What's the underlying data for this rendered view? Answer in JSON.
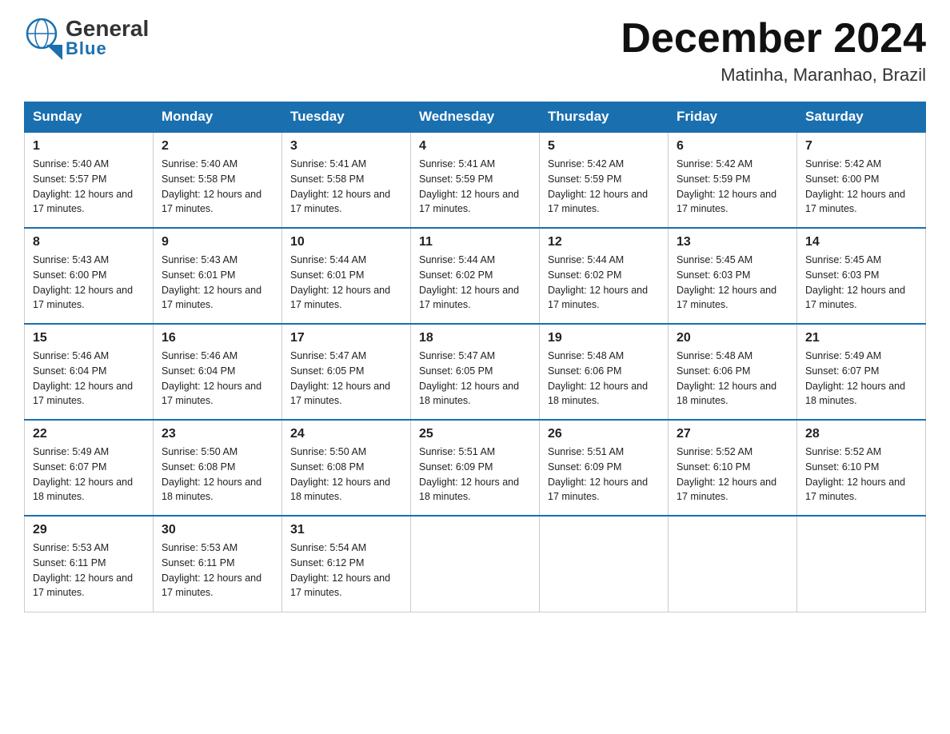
{
  "header": {
    "logo_general": "General",
    "logo_blue": "Blue",
    "month_title": "December 2024",
    "location": "Matinha, Maranhao, Brazil"
  },
  "days_of_week": [
    "Sunday",
    "Monday",
    "Tuesday",
    "Wednesday",
    "Thursday",
    "Friday",
    "Saturday"
  ],
  "weeks": [
    [
      {
        "day": "1",
        "sunrise": "5:40 AM",
        "sunset": "5:57 PM",
        "daylight": "12 hours and 17 minutes."
      },
      {
        "day": "2",
        "sunrise": "5:40 AM",
        "sunset": "5:58 PM",
        "daylight": "12 hours and 17 minutes."
      },
      {
        "day": "3",
        "sunrise": "5:41 AM",
        "sunset": "5:58 PM",
        "daylight": "12 hours and 17 minutes."
      },
      {
        "day": "4",
        "sunrise": "5:41 AM",
        "sunset": "5:59 PM",
        "daylight": "12 hours and 17 minutes."
      },
      {
        "day": "5",
        "sunrise": "5:42 AM",
        "sunset": "5:59 PM",
        "daylight": "12 hours and 17 minutes."
      },
      {
        "day": "6",
        "sunrise": "5:42 AM",
        "sunset": "5:59 PM",
        "daylight": "12 hours and 17 minutes."
      },
      {
        "day": "7",
        "sunrise": "5:42 AM",
        "sunset": "6:00 PM",
        "daylight": "12 hours and 17 minutes."
      }
    ],
    [
      {
        "day": "8",
        "sunrise": "5:43 AM",
        "sunset": "6:00 PM",
        "daylight": "12 hours and 17 minutes."
      },
      {
        "day": "9",
        "sunrise": "5:43 AM",
        "sunset": "6:01 PM",
        "daylight": "12 hours and 17 minutes."
      },
      {
        "day": "10",
        "sunrise": "5:44 AM",
        "sunset": "6:01 PM",
        "daylight": "12 hours and 17 minutes."
      },
      {
        "day": "11",
        "sunrise": "5:44 AM",
        "sunset": "6:02 PM",
        "daylight": "12 hours and 17 minutes."
      },
      {
        "day": "12",
        "sunrise": "5:44 AM",
        "sunset": "6:02 PM",
        "daylight": "12 hours and 17 minutes."
      },
      {
        "day": "13",
        "sunrise": "5:45 AM",
        "sunset": "6:03 PM",
        "daylight": "12 hours and 17 minutes."
      },
      {
        "day": "14",
        "sunrise": "5:45 AM",
        "sunset": "6:03 PM",
        "daylight": "12 hours and 17 minutes."
      }
    ],
    [
      {
        "day": "15",
        "sunrise": "5:46 AM",
        "sunset": "6:04 PM",
        "daylight": "12 hours and 17 minutes."
      },
      {
        "day": "16",
        "sunrise": "5:46 AM",
        "sunset": "6:04 PM",
        "daylight": "12 hours and 17 minutes."
      },
      {
        "day": "17",
        "sunrise": "5:47 AM",
        "sunset": "6:05 PM",
        "daylight": "12 hours and 17 minutes."
      },
      {
        "day": "18",
        "sunrise": "5:47 AM",
        "sunset": "6:05 PM",
        "daylight": "12 hours and 18 minutes."
      },
      {
        "day": "19",
        "sunrise": "5:48 AM",
        "sunset": "6:06 PM",
        "daylight": "12 hours and 18 minutes."
      },
      {
        "day": "20",
        "sunrise": "5:48 AM",
        "sunset": "6:06 PM",
        "daylight": "12 hours and 18 minutes."
      },
      {
        "day": "21",
        "sunrise": "5:49 AM",
        "sunset": "6:07 PM",
        "daylight": "12 hours and 18 minutes."
      }
    ],
    [
      {
        "day": "22",
        "sunrise": "5:49 AM",
        "sunset": "6:07 PM",
        "daylight": "12 hours and 18 minutes."
      },
      {
        "day": "23",
        "sunrise": "5:50 AM",
        "sunset": "6:08 PM",
        "daylight": "12 hours and 18 minutes."
      },
      {
        "day": "24",
        "sunrise": "5:50 AM",
        "sunset": "6:08 PM",
        "daylight": "12 hours and 18 minutes."
      },
      {
        "day": "25",
        "sunrise": "5:51 AM",
        "sunset": "6:09 PM",
        "daylight": "12 hours and 18 minutes."
      },
      {
        "day": "26",
        "sunrise": "5:51 AM",
        "sunset": "6:09 PM",
        "daylight": "12 hours and 17 minutes."
      },
      {
        "day": "27",
        "sunrise": "5:52 AM",
        "sunset": "6:10 PM",
        "daylight": "12 hours and 17 minutes."
      },
      {
        "day": "28",
        "sunrise": "5:52 AM",
        "sunset": "6:10 PM",
        "daylight": "12 hours and 17 minutes."
      }
    ],
    [
      {
        "day": "29",
        "sunrise": "5:53 AM",
        "sunset": "6:11 PM",
        "daylight": "12 hours and 17 minutes."
      },
      {
        "day": "30",
        "sunrise": "5:53 AM",
        "sunset": "6:11 PM",
        "daylight": "12 hours and 17 minutes."
      },
      {
        "day": "31",
        "sunrise": "5:54 AM",
        "sunset": "6:12 PM",
        "daylight": "12 hours and 17 minutes."
      },
      null,
      null,
      null,
      null
    ]
  ]
}
